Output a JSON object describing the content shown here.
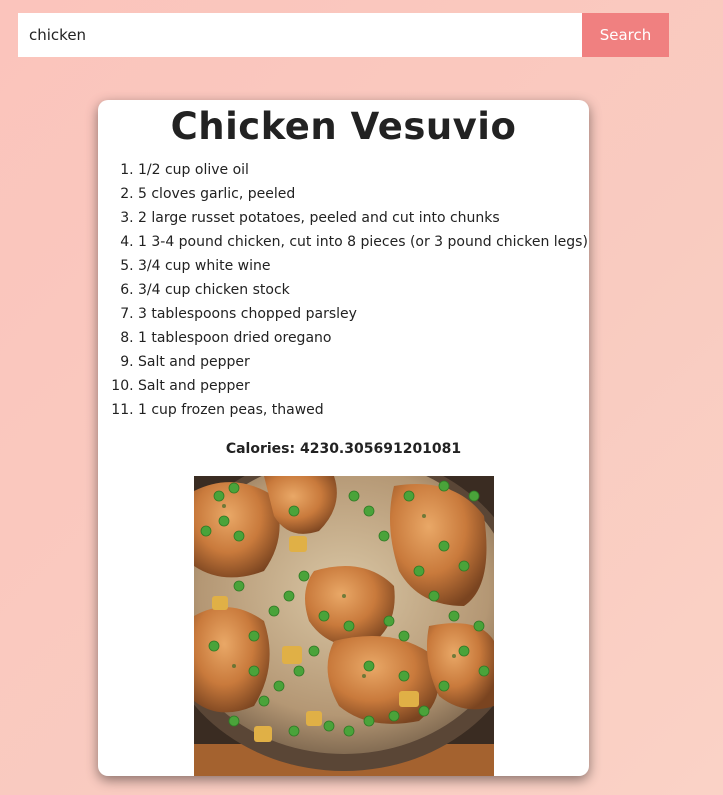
{
  "search": {
    "value": "chicken",
    "button_label": "Search"
  },
  "recipe": {
    "title": "Chicken Vesuvio",
    "ingredients": [
      "1/2 cup olive oil",
      "5 cloves garlic, peeled",
      "2 large russet potatoes, peeled and cut into chunks",
      "1 3-4 pound chicken, cut into 8 pieces (or 3 pound chicken legs)",
      "3/4 cup white wine",
      "3/4 cup chicken stock",
      "3 tablespoons chopped parsley",
      "1 tablespoon dried oregano",
      "Salt and pepper",
      "Salt and pepper",
      "1 cup frozen peas, thawed"
    ],
    "calories": "Calories: 4230.305691201081"
  },
  "colors": {
    "accent": "#f08080",
    "background": "#fbc8bf"
  }
}
